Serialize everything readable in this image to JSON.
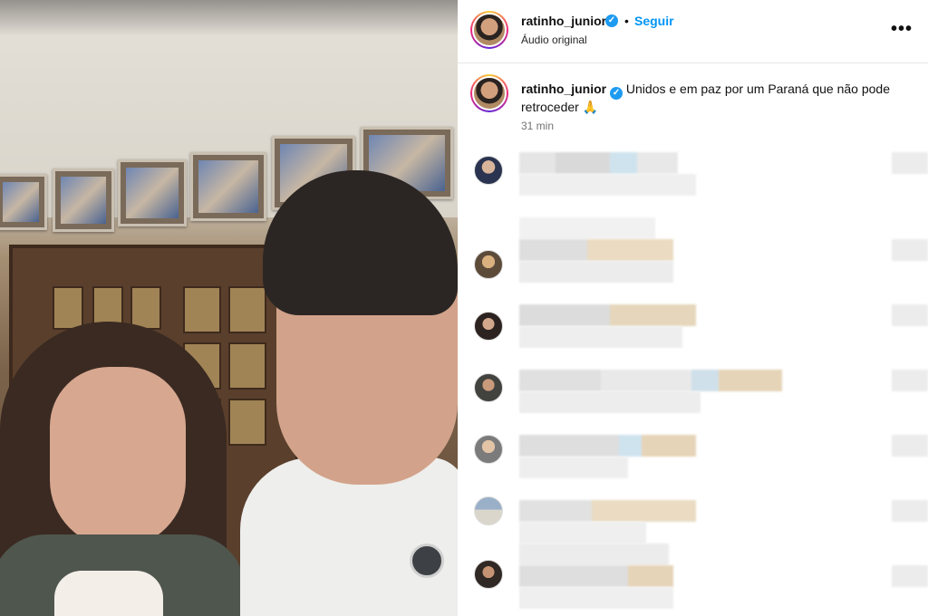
{
  "post": {
    "username": "ratinho_junior",
    "verified_mark": "✓",
    "separator": "•",
    "follow_label": "Seguir",
    "audio_label": "Áudio original",
    "more_label": "•••"
  },
  "caption": {
    "username": "ratinho_junior",
    "text": "Unidos e em paz por um Paraná que não pode retroceder",
    "emoji": "🙏",
    "time": "31 min"
  },
  "comments": {
    "count_visible": 7,
    "note_blurred": true
  },
  "icons": {
    "verified": "verified-badge-icon",
    "more": "more-options-icon"
  },
  "colors": {
    "follow": "#0095f6",
    "verified": "#1d9bf0",
    "timestamp": "#737373"
  }
}
